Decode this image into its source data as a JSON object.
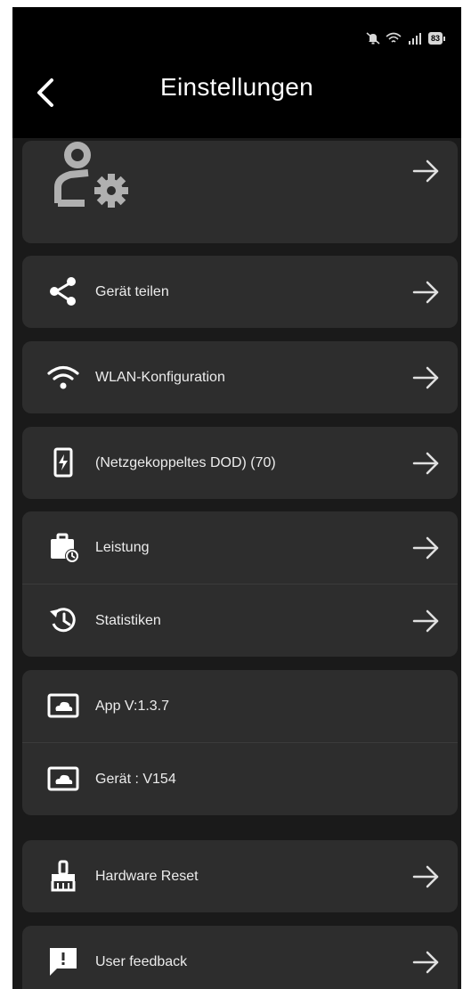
{
  "header": {
    "title": "Einstellungen"
  },
  "status_bar": {
    "battery": "83"
  },
  "settings": {
    "share_device": "Gerät teilen",
    "wlan_config": "WLAN-Konfiguration",
    "grid_dod": "(Netzgekoppeltes DOD)  (70)",
    "performance": "Leistung",
    "statistics": "Statistiken",
    "app_version": "App V:1.3.7",
    "device_version": "Gerät : V154",
    "hardware_reset": "Hardware Reset",
    "user_feedback": "User feedback"
  },
  "colors": {
    "background": "#1a1a1a",
    "card": "#2d2d2d",
    "header": "#000000",
    "text": "#ececec",
    "icon": "#b0b0b0"
  },
  "icons": [
    "user-settings-icon",
    "share-icon",
    "wifi-icon",
    "battery-flash-icon",
    "briefcase-clock-icon",
    "history-icon",
    "cloud-image-icon",
    "brush-icon",
    "feedback-icon",
    "arrow-right-icon",
    "chevron-left-icon"
  ]
}
